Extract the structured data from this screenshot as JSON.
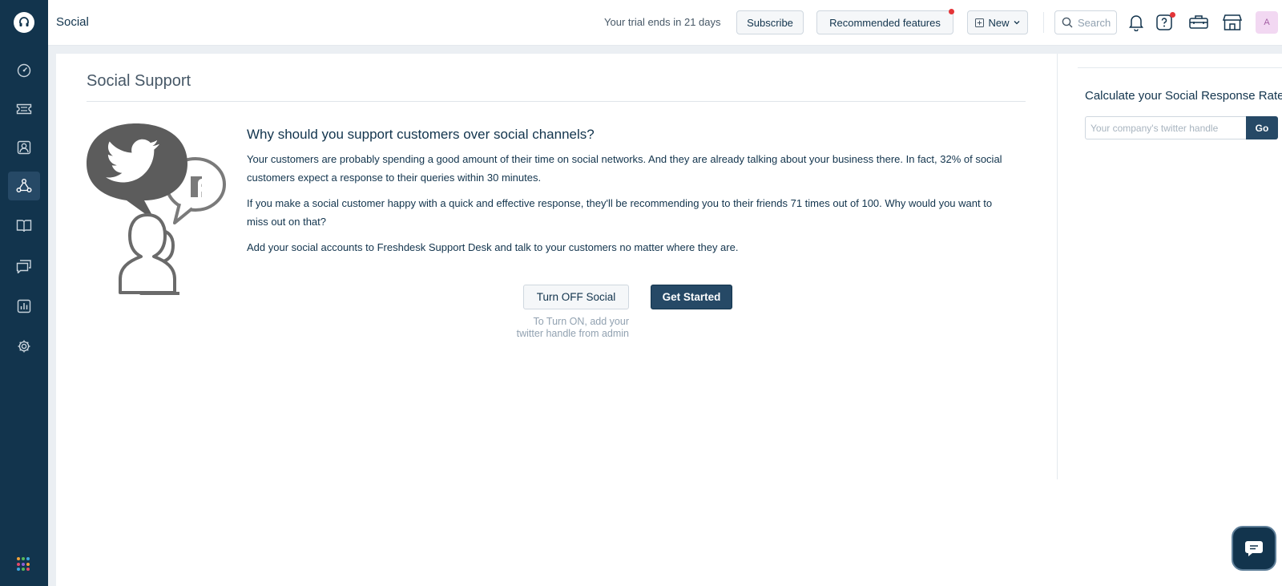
{
  "header": {
    "title": "Social",
    "trial_text": "Your trial ends in 21 days",
    "subscribe_label": "Subscribe",
    "recommended_label": "Recommended features",
    "new_label": "New",
    "search_placeholder": "Search",
    "avatar_initial": "A"
  },
  "leftnav": {
    "items": [
      "dashboard-icon",
      "tickets-icon",
      "contacts-icon",
      "social-icon",
      "solutions-icon",
      "forums-icon",
      "reports-icon",
      "admin-icon"
    ],
    "active": "social-icon"
  },
  "main": {
    "section_title": "Social Support",
    "question": "Why should you support customers over social channels?",
    "para1": "Your customers are probably spending a good amount of their time on social networks. And they are already talking about your business there. In fact, 32% of social customers expect a response to their queries within 30 minutes.",
    "para2": "If you make a social customer happy with a quick and effective response, they'll be recommending you to their friends 71 times out of 100. Why would you want to miss out on that?",
    "para3": "Add your social accounts to Freshdesk Support Desk and talk to your customers no matter where they are.",
    "turn_off_label": "Turn OFF Social",
    "get_started_label": "Get Started",
    "hint_line1": "To Turn ON, add your",
    "hint_line2": "twitter handle from admin"
  },
  "right": {
    "calc_title": "Calculate your Social Response Rate",
    "handle_placeholder": "Your company's twitter handle",
    "go_label": "Go"
  },
  "colors": {
    "nav_bg": "#12344d",
    "nav_active": "#264966",
    "primary_btn": "#264966",
    "notification_dot": "#e43538",
    "illustration_dark": "#5c5c5c",
    "illustration_light": "#7a7a7a"
  }
}
